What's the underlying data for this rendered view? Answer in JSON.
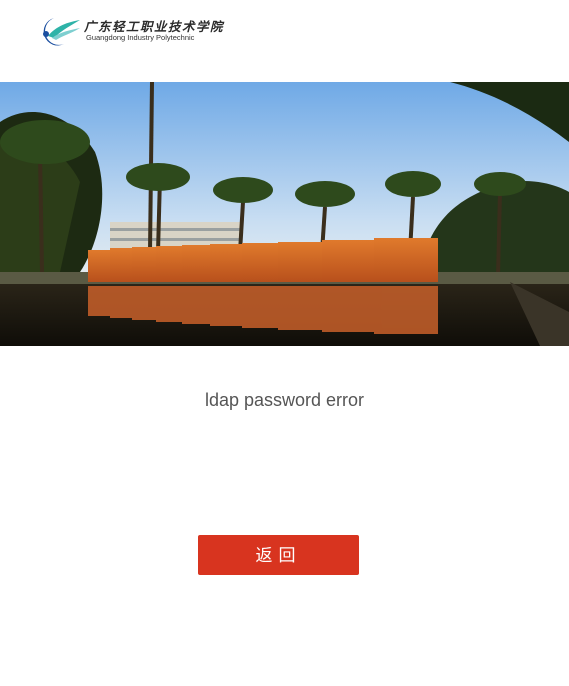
{
  "header": {
    "logo_cn": "广东轻工职业技术学院",
    "logo_en": "Guangdong Industry Polytechnic"
  },
  "hero": {
    "image": "campus-gate-photo"
  },
  "main": {
    "message": "ldap password error",
    "back_button_label": "返回"
  },
  "colors": {
    "button_bg": "#d8341f",
    "message_text": "#555555"
  }
}
